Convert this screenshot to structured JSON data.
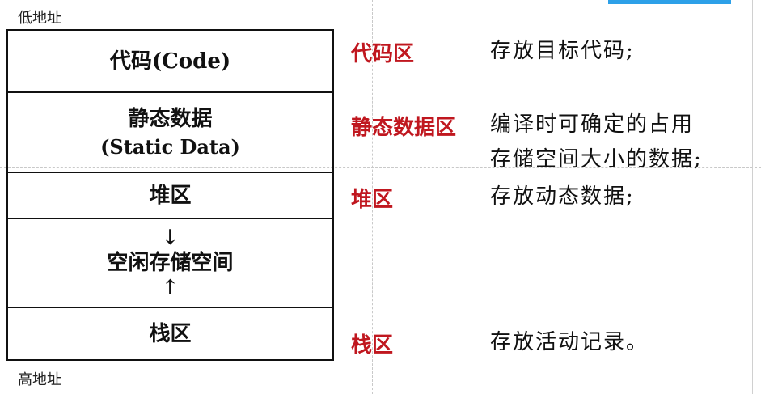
{
  "addresses": {
    "low": "低地址",
    "high": "高地址"
  },
  "memory_layout": {
    "code": "代码(Code)",
    "static_line1": "静态数据",
    "static_line2": "(Static Data)",
    "heap": "堆区",
    "free_down_arrow": "↓",
    "free": "空闲存储空间",
    "free_up_arrow": "↑",
    "stack": "栈区"
  },
  "segments": [
    {
      "name": "代码区",
      "desc": [
        "存放目标代码;"
      ]
    },
    {
      "name": "静态数据区",
      "desc": [
        "编译时可确定的占用",
        "存储空间大小的数据;"
      ]
    },
    {
      "name": "堆区",
      "desc": [
        "存放动态数据;"
      ]
    },
    {
      "name": "栈区",
      "desc": [
        "存放活动记录。"
      ]
    }
  ],
  "colors": {
    "segment_label": "#c0171f",
    "accent_bar": "#2da0e8"
  }
}
